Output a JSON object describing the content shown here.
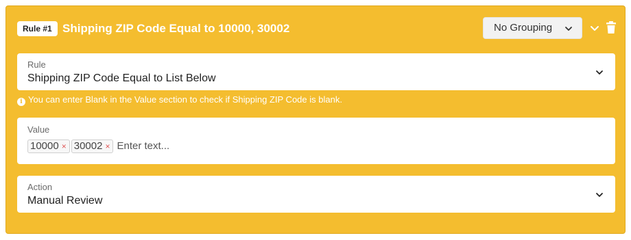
{
  "rule": {
    "badge": "Rule #1",
    "title": "Shipping ZIP Code Equal to 10000, 30002",
    "grouping": "No Grouping"
  },
  "fields": {
    "rule_label": "Rule",
    "rule_value": "Shipping ZIP Code Equal to List Below",
    "hint": "You can enter Blank in the Value section to check if Shipping ZIP Code is blank.",
    "value_label": "Value",
    "tags": [
      "10000",
      "30002"
    ],
    "tag_remove": "×",
    "value_placeholder": "Enter text...",
    "action_label": "Action",
    "action_value": "Manual Review"
  },
  "icons": {
    "info": "i",
    "chevron": "chevron-down-icon",
    "delete": "trash-icon"
  },
  "colors": {
    "card_background": "#f4bd2f",
    "tag_remove": "#e05555"
  }
}
